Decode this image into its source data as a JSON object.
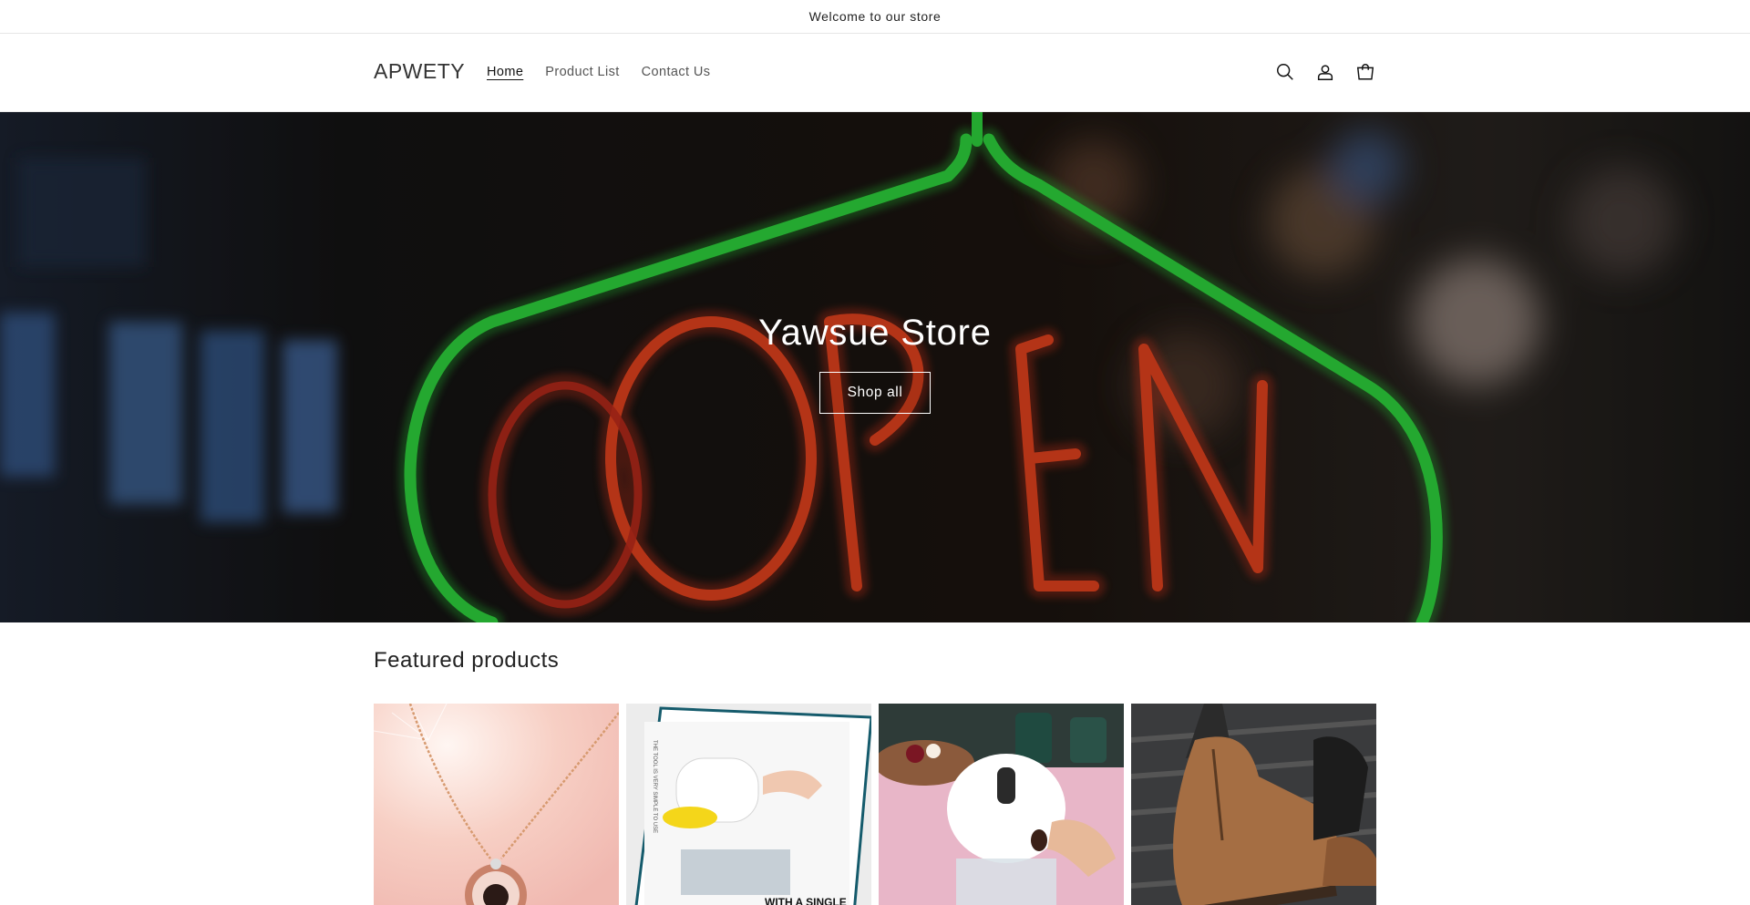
{
  "announcement": {
    "text": "Welcome to our store"
  },
  "header": {
    "logo": "APWETY",
    "nav": [
      {
        "label": "Home",
        "active": true
      },
      {
        "label": "Product List",
        "active": false
      },
      {
        "label": "Contact Us",
        "active": false
      }
    ],
    "icons": [
      "search-icon",
      "account-icon",
      "cart-icon"
    ]
  },
  "hero": {
    "title": "Yawsue Store",
    "button_label": "Shop all",
    "image": "neon-open-sign"
  },
  "featured": {
    "title": "Featured products",
    "products": [
      {
        "image": "pendant-necklace"
      },
      {
        "image": "electric-cleaning-brush"
      },
      {
        "image": "food-chopper"
      },
      {
        "image": "leather-boots"
      }
    ]
  },
  "colors": {
    "neon_green": "#2bd63a",
    "neon_red": "#e8391c",
    "text": "#121212"
  }
}
